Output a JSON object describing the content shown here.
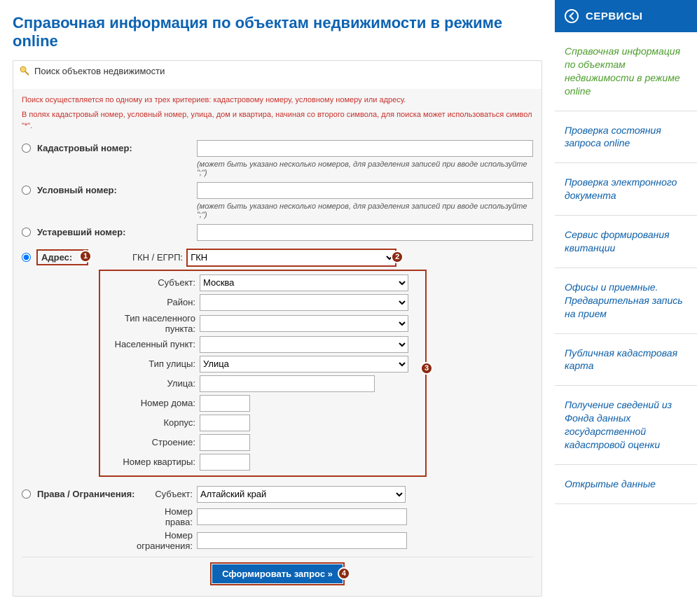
{
  "pageTitle": "Справочная информация по объектам недвижимости в режиме online",
  "services": {
    "header": "СЕРВИСЫ",
    "items": [
      "Справочная информация по объектам недвижимости в режиме online",
      "Проверка состояния запроса online",
      "Проверка электронного документа",
      "Сервис формирования квитанции",
      "Офисы и приемные. Предварительная запись на прием",
      "Публичная кадастровая карта",
      "Получение сведений из Фонда данных государственной кадастровой оценки",
      "Открытые данные"
    ]
  },
  "panel": {
    "legend": "Поиск объектов недвижимости",
    "info1": "Поиск осуществляется по одному из трех критериев: кадастровому номеру, условному номеру или адресу.",
    "info2": "В полях кадастровый номер, условный номер, улица, дом и квартира, начиная со второго символа, для поиска может использоваться символ \"*\"."
  },
  "labels": {
    "cadNum": "Кадастровый номер:",
    "condNum": "Условный номер:",
    "oldNum": "Устаревший номер:",
    "address": "Адрес:",
    "gkn": "ГКН / ЕГРП:",
    "subject": "Субъект:",
    "district": "Район:",
    "settlementType": "Тип населенного пункта:",
    "settlement": "Населенный пункт:",
    "streetType": "Тип улицы:",
    "street": "Улица:",
    "house": "Номер дома:",
    "building": "Корпус:",
    "structure": "Строение:",
    "apt": "Номер квартиры:",
    "rights": "Права / Ограничения:",
    "rightsSubject": "Субъект:",
    "rightsNum": "Номер права:",
    "restrictNum": "Номер ограничения:",
    "hintMulti": "(может быть указано несколько номеров, для разделения записей при вводе используйте \";\")"
  },
  "values": {
    "gknSel": "ГКН",
    "subjectSel": "Москва",
    "streetTypeSel": "Улица",
    "rightsSubjectSel": "Алтайский край"
  },
  "submit": "Сформировать запрос »",
  "markers": {
    "m1": "1",
    "m2": "2",
    "m3": "3",
    "m4": "4"
  }
}
